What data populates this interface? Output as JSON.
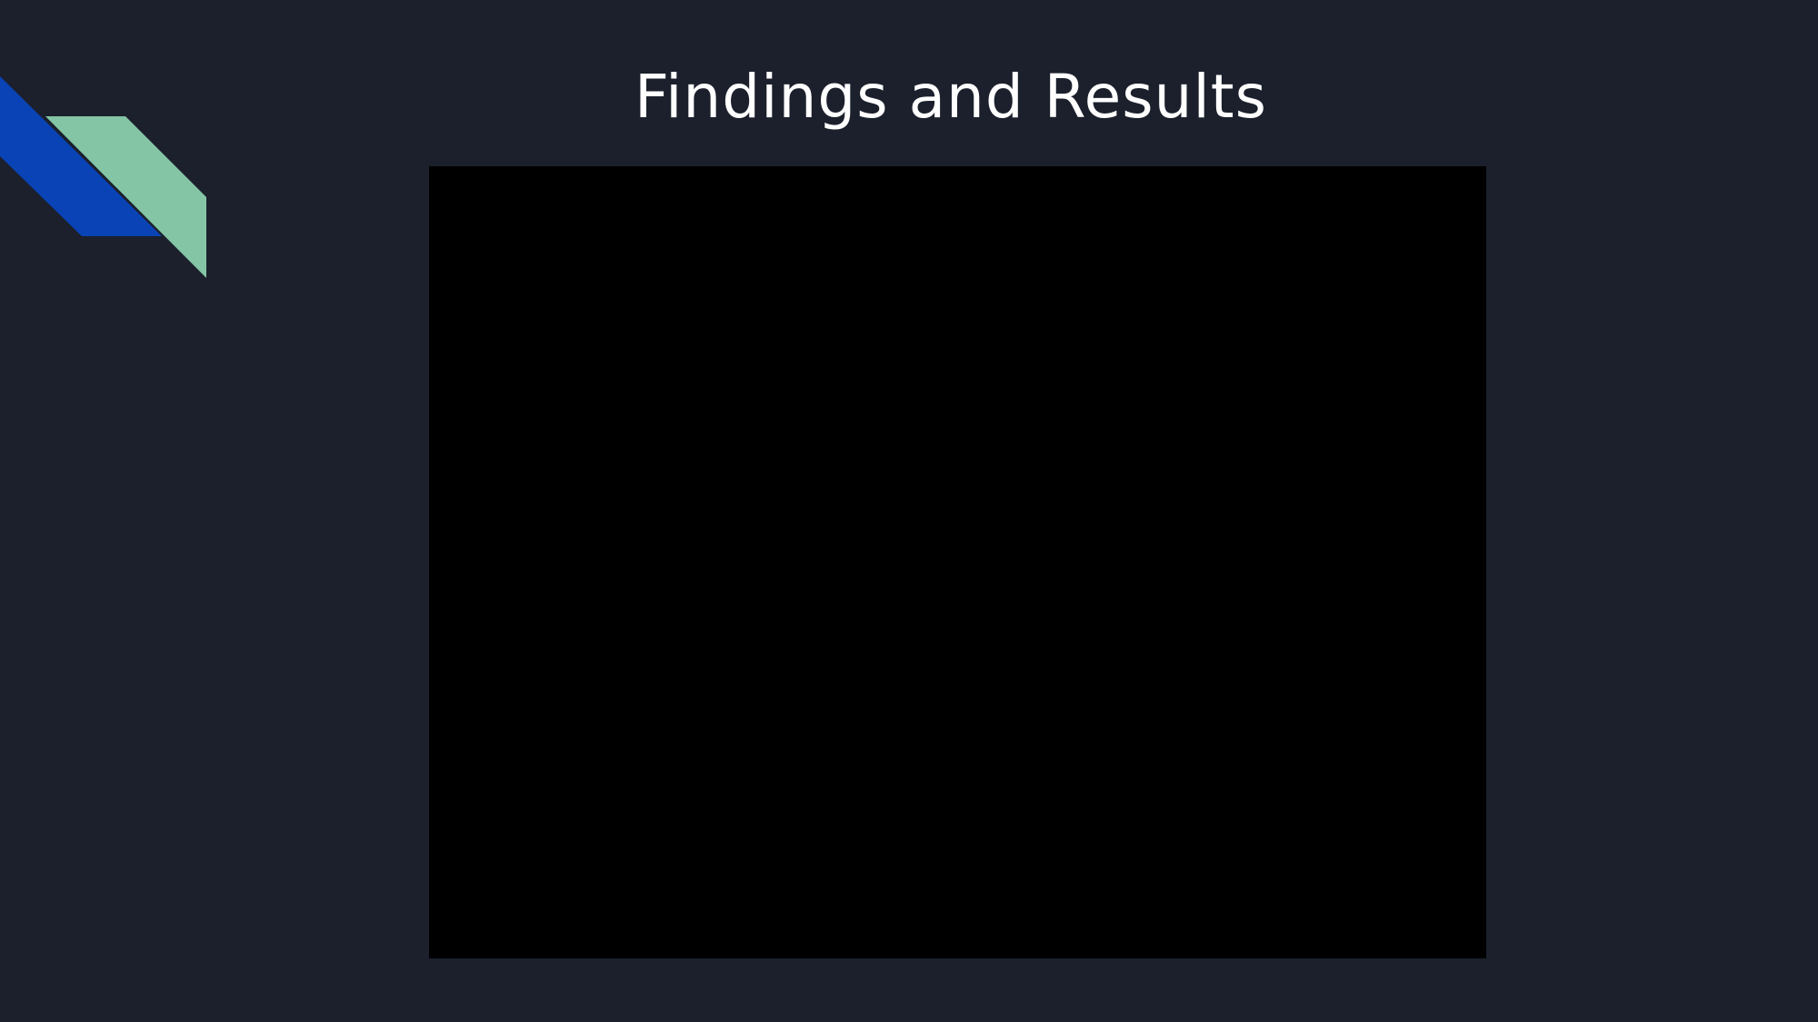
{
  "slide": {
    "title": "Findings and Results"
  },
  "colors": {
    "background": "#1b202c",
    "accent_blue": "#0a43b5",
    "accent_green": "#84c5a5",
    "media_fill": "#000000",
    "title_text": "#ffffff"
  },
  "icons": {
    "decor": "diagonal-ribbon-shapes"
  }
}
